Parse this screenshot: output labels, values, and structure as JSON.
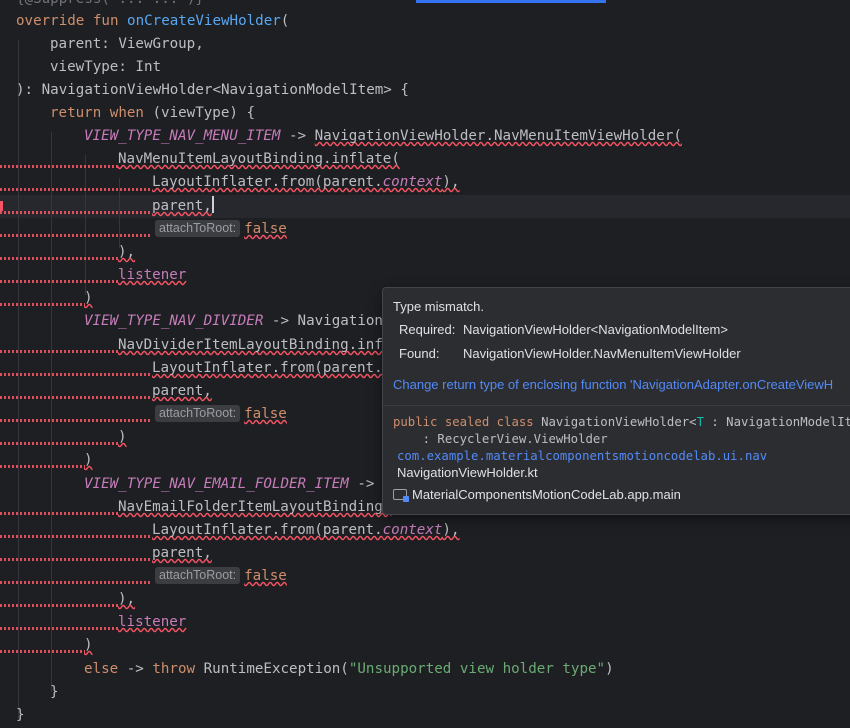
{
  "code": {
    "line0": "{@Suppress(\"... ...\")}",
    "override_kw": "override fun",
    "fn_name": "onCreateViewHolder",
    "open_paren": "(",
    "param_parent": "parent: ViewGroup,",
    "param_viewtype": "viewType: Int",
    "return_sig": "): NavigationViewHolder<NavigationModelItem> {",
    "return_kw": "return",
    "when_kw": "when",
    "when_arg": " (viewType) {",
    "const_menu": "VIEW_TYPE_NAV_MENU_ITEM",
    "arrow": " -> ",
    "menu_holder": "NavigationViewHolder.NavMenuItemViewHolder(",
    "menu_binding": "NavMenuItemLayoutBinding.inflate(",
    "inflater_from": "LayoutInflater.from(parent.",
    "context_prop": "context",
    "inflater_close": "),",
    "parent_arg": "parent,",
    "hint_attach": "attachToRoot:",
    "false_kw": "false",
    "close_paren_comma": "),",
    "listener": "listener",
    "close_paren": ")",
    "const_divider": "VIEW_TYPE_NAV_DIVIDER",
    "divider_holder_partial": "Navigation",
    "divider_binding_partial": "NavDividerItemLayoutBinding.inf",
    "inflater_partial": "LayoutInflater.from(parent.",
    "const_email": "VIEW_TYPE_NAV_EMAIL_FOLDER_ITEM",
    "arrow_partial": " ->",
    "email_binding_partial": "NavEmailFolderItemLayoutBinding.",
    "else_kw": "else",
    "throw_kw": "throw",
    "exception_call": "RuntimeException(",
    "exception_msg": "\"Unsupported view holder type\"",
    "close_brace": "}"
  },
  "popup": {
    "title": "Type mismatch.",
    "required_label": "Required:",
    "required_value": "NavigationViewHolder<NavigationModelItem>",
    "found_label": "Found:",
    "found_value": "NavigationViewHolder.NavMenuItemViewHolder",
    "quick_fix": "Change return type of enclosing function 'NavigationAdapter.onCreateViewH",
    "decl_kw": "public sealed class",
    "decl_name": "NavigationViewHolder<",
    "decl_type_param": "T",
    "decl_rest": " : NavigationModelItem>",
    "decl_super": "    : RecyclerView.ViewHolder",
    "package": "com.example.materialcomponentsmotioncodelab.ui.nav",
    "file": "NavigationViewHolder.kt",
    "module_icon": "module-folder-icon",
    "module": "MaterialComponentsMotionCodeLab.app.main"
  },
  "colors": {
    "background": "#1e1f22",
    "keyword": "#cf8e6d",
    "function": "#56a8f5",
    "constant": "#c77dbb",
    "string": "#6aab73",
    "error": "#f75464",
    "link": "#548af7"
  }
}
